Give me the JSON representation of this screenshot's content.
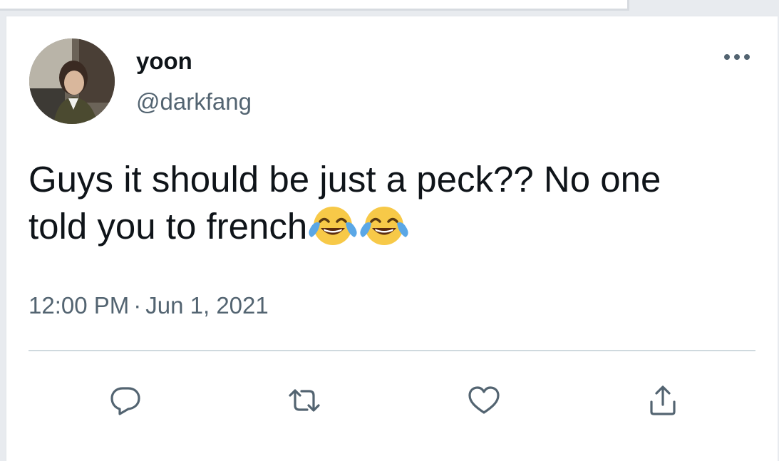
{
  "tweet": {
    "display_name": "yoon",
    "handle": "@darkfang",
    "text_line1": "Guys it should be just a peck?? No one",
    "text_line2": "told you to french",
    "emojis": [
      "face-with-tears-of-joy",
      "face-with-tears-of-joy"
    ],
    "time": "12:00 PM",
    "separator": "·",
    "date": "Jun 1, 2021"
  },
  "actions": [
    {
      "name": "reply",
      "icon": "speech-bubble-icon"
    },
    {
      "name": "retweet",
      "icon": "retweet-arrows-icon"
    },
    {
      "name": "like",
      "icon": "heart-icon"
    },
    {
      "name": "share",
      "icon": "share-upload-icon"
    }
  ],
  "colors": {
    "text_primary": "#0f1419",
    "text_secondary": "#536471",
    "divider": "#cfd9de",
    "background": "#ffffff"
  }
}
